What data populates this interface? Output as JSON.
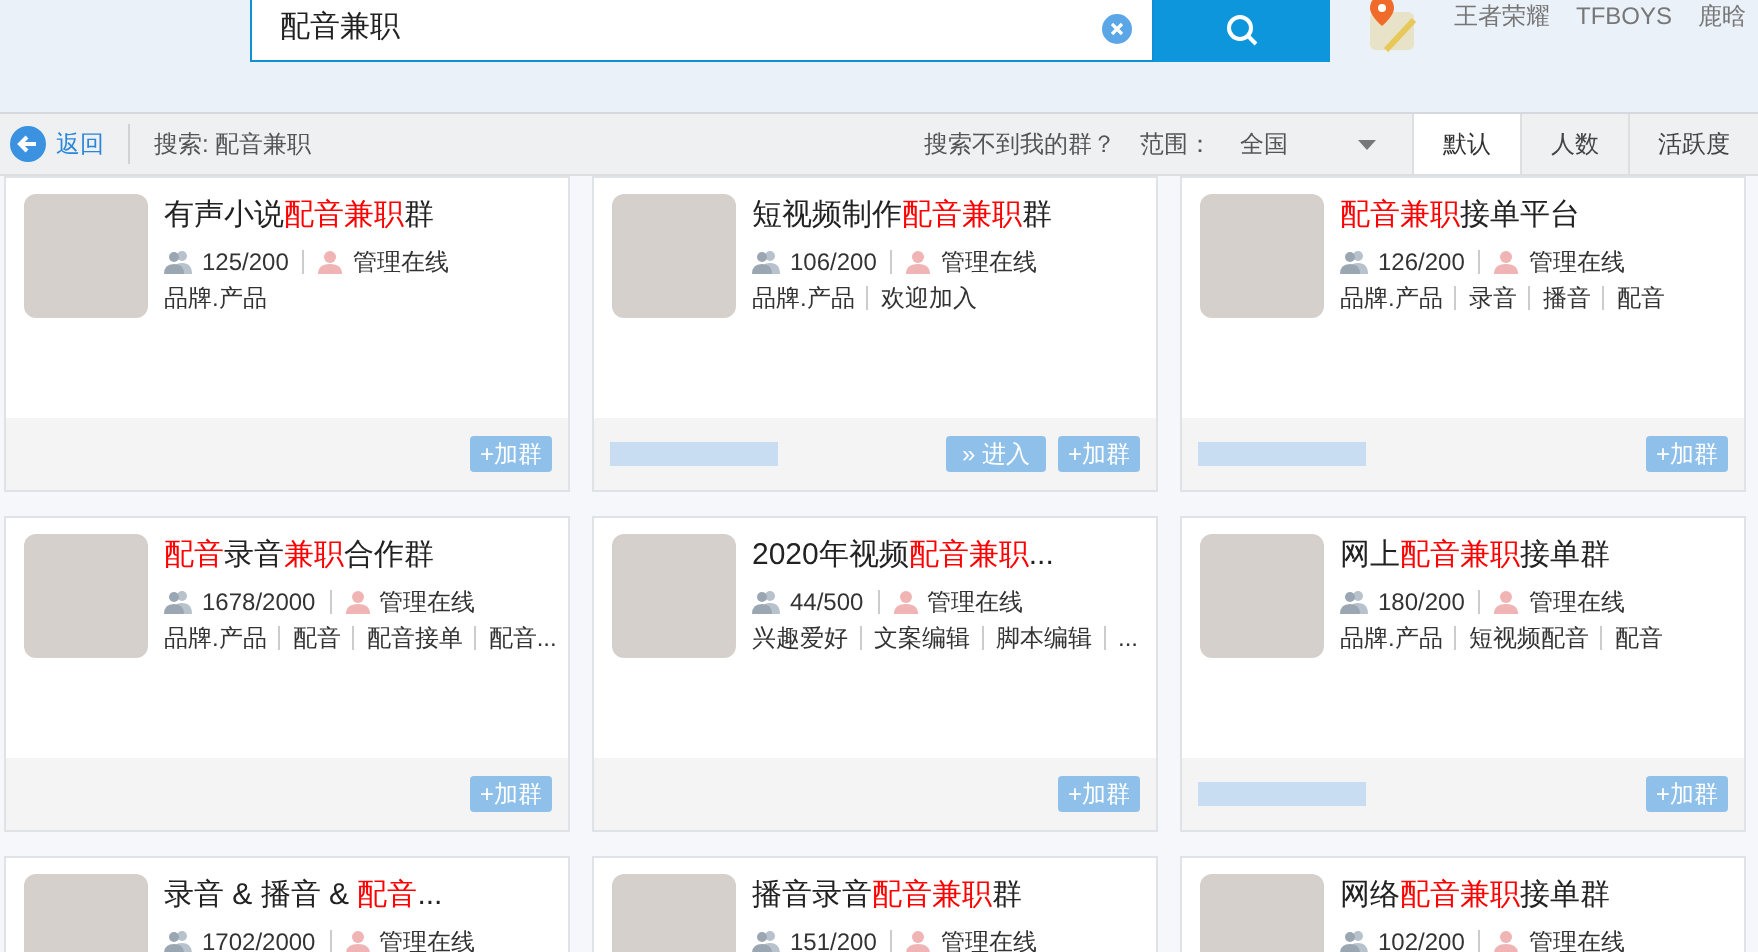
{
  "search": {
    "value": "配音兼职"
  },
  "hot_words": [
    "王者荣耀",
    "TFBOYS",
    "鹿晗"
  ],
  "toolbar": {
    "back": "返回",
    "query": "搜索: 配音兼职",
    "not_found": "搜索不到我的群？",
    "range_label": "范围：",
    "range_value": "全国"
  },
  "sort_tabs": [
    {
      "label": "默认",
      "selected": true
    },
    {
      "label": "人数",
      "selected": false
    },
    {
      "label": "活跃度",
      "selected": false
    }
  ],
  "groups": [
    {
      "title": [
        {
          "text": "有声小说",
          "highlight": false
        },
        {
          "text": "配音兼职",
          "highlight": true
        },
        {
          "text": "群",
          "highlight": false
        }
      ],
      "members": "125/200",
      "admin": "管理在线",
      "tags": [
        "品牌.产品"
      ],
      "masked_footer": false,
      "buttons": [
        {
          "kind": "join",
          "label": "+加群"
        }
      ]
    },
    {
      "title": [
        {
          "text": "短视频制作",
          "highlight": false
        },
        {
          "text": "配音兼职",
          "highlight": true
        },
        {
          "text": "群",
          "highlight": false
        }
      ],
      "members": "106/200",
      "admin": "管理在线",
      "tags": [
        "品牌.产品",
        "欢迎加入"
      ],
      "masked_footer": true,
      "buttons": [
        {
          "kind": "enter",
          "label": "» 进入"
        },
        {
          "kind": "join",
          "label": "+加群"
        }
      ]
    },
    {
      "title": [
        {
          "text": "配音兼职",
          "highlight": true
        },
        {
          "text": "接单平台",
          "highlight": false
        }
      ],
      "members": "126/200",
      "admin": "管理在线",
      "tags": [
        "品牌.产品",
        "录音",
        "播音",
        "配音"
      ],
      "masked_footer": true,
      "buttons": [
        {
          "kind": "join",
          "label": "+加群"
        }
      ]
    },
    {
      "title": [
        {
          "text": "配音",
          "highlight": true
        },
        {
          "text": "录音",
          "highlight": false
        },
        {
          "text": "兼职",
          "highlight": true
        },
        {
          "text": "合作群",
          "highlight": false
        }
      ],
      "members": "1678/2000",
      "admin": "管理在线",
      "tags": [
        "品牌.产品",
        "配音",
        "配音接单",
        "配音..."
      ],
      "masked_footer": false,
      "buttons": [
        {
          "kind": "join",
          "label": "+加群"
        }
      ]
    },
    {
      "title": [
        {
          "text": "2020年视频",
          "highlight": false
        },
        {
          "text": "配音兼职",
          "highlight": true
        },
        {
          "text": "...",
          "highlight": false
        }
      ],
      "members": "44/500",
      "admin": "管理在线",
      "tags": [
        "兴趣爱好",
        "文案编辑",
        "脚本编辑",
        "..."
      ],
      "masked_footer": false,
      "buttons": [
        {
          "kind": "join",
          "label": "+加群"
        }
      ]
    },
    {
      "title": [
        {
          "text": "网上",
          "highlight": false
        },
        {
          "text": "配音兼职",
          "highlight": true
        },
        {
          "text": "接单群",
          "highlight": false
        }
      ],
      "members": "180/200",
      "admin": "管理在线",
      "tags": [
        "品牌.产品",
        "短视频配音",
        "配音"
      ],
      "masked_footer": true,
      "buttons": [
        {
          "kind": "join",
          "label": "+加群"
        }
      ]
    },
    {
      "title": [
        {
          "text": "录音 & 播音 & ",
          "highlight": false
        },
        {
          "text": "配音",
          "highlight": true
        },
        {
          "text": "...",
          "highlight": false
        }
      ],
      "members": "1702/2000",
      "admin": "管理在线"
    },
    {
      "title": [
        {
          "text": "播音录音",
          "highlight": false
        },
        {
          "text": "配音兼职",
          "highlight": true
        },
        {
          "text": "群",
          "highlight": false
        }
      ],
      "members": "151/200",
      "admin": "管理在线"
    },
    {
      "title": [
        {
          "text": "网络",
          "highlight": false
        },
        {
          "text": "配音兼职",
          "highlight": true
        },
        {
          "text": "接单群",
          "highlight": false
        }
      ],
      "members": "102/200",
      "admin": "管理在线"
    }
  ]
}
